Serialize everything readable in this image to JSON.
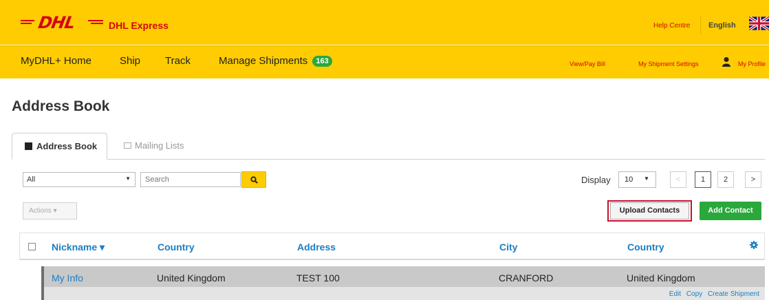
{
  "header": {
    "brand_logo_text": "DHL",
    "brand_name": "DHL Express",
    "help_link": "Help Centre",
    "language": "English",
    "flag_icon": "uk-flag-icon",
    "brand_color": "#d40511",
    "bar_color": "#fecc00"
  },
  "nav": {
    "home": "MyDHL+ Home",
    "ship": "Ship",
    "track": "Track",
    "manage": "Manage Shipments",
    "manage_count": "163",
    "view_pay_bill": "View/Pay Bill",
    "shipment_settings": "My Shipment Settings",
    "profile": "My Profile"
  },
  "page": {
    "title": "Address Book"
  },
  "tabs": [
    {
      "label": "Address Book",
      "icon": "address-book-icon",
      "active": true
    },
    {
      "label": "Mailing Lists",
      "icon": "mailing-list-icon",
      "active": false
    }
  ],
  "toolbar": {
    "filter_value": "All",
    "search_placeholder": "Search",
    "display_label": "Display",
    "display_value": "10",
    "pages": [
      "<",
      "1",
      "2",
      ">"
    ],
    "current_page": "1",
    "actions_label": "Actions ▾",
    "upload_label": "Upload Contacts",
    "add_label": "Add Contact",
    "add_color": "#2aa83c",
    "highlight_color": "#c8102e"
  },
  "table": {
    "columns": [
      "Nickname ▾",
      "Country",
      "Address",
      "City",
      "Country"
    ],
    "rows": [
      {
        "nickname": "My Info",
        "country": "United Kingdom",
        "address": "TEST 100",
        "city": "CRANFORD",
        "country2": "United Kingdom",
        "actions": [
          "Edit",
          "Copy",
          "Create Shipment"
        ]
      }
    ]
  }
}
